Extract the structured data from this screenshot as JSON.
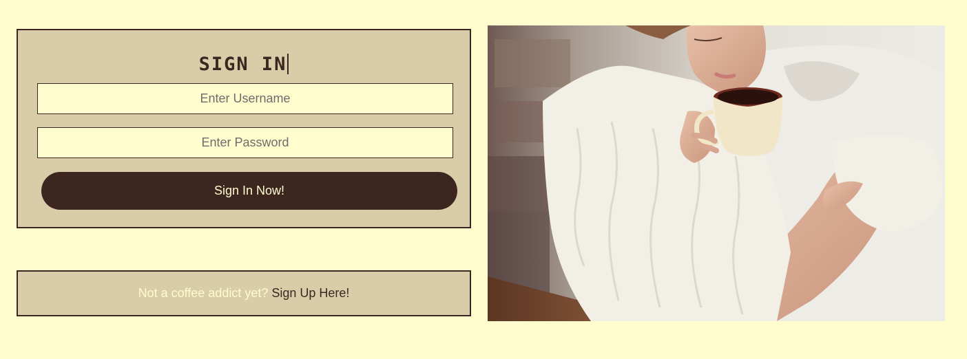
{
  "signin": {
    "title": "SIGN IN",
    "username_placeholder": "Enter Username",
    "password_placeholder": "Enter Password",
    "submit_label": "Sign In Now!"
  },
  "signup": {
    "prompt": "Not a coffee addict yet?",
    "link_label": "Sign Up Here!"
  },
  "colors": {
    "background": "#fffccd",
    "card": "#d8cda8",
    "accent": "#3d2620"
  },
  "photo": {
    "icon": "woman-drinking-coffee-photo"
  }
}
